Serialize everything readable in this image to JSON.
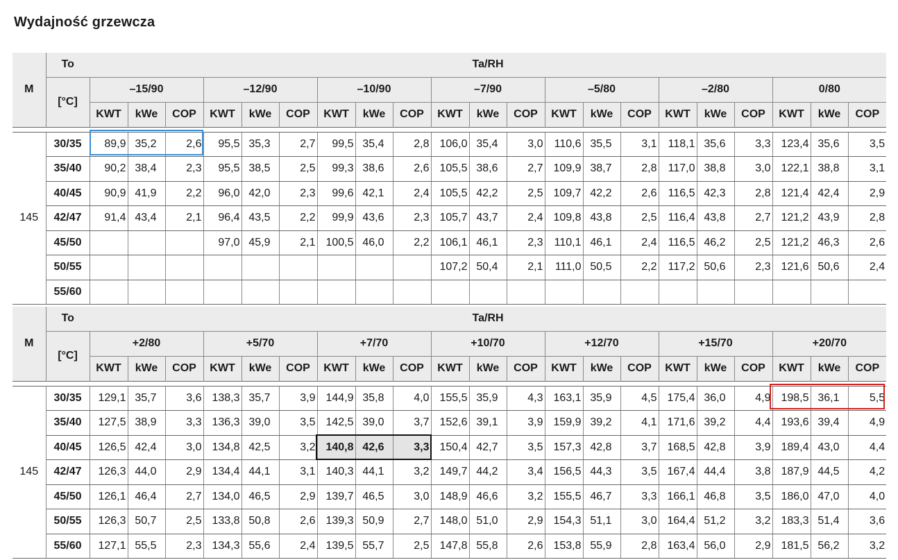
{
  "title": "Wydajność grzewcza",
  "labels": {
    "m": "M",
    "to": "To",
    "deg": "[°C]",
    "tarh": "Ta/RH",
    "kwt": "KWT",
    "kwe": "kWe",
    "cop": "COP"
  },
  "tables": [
    {
      "model": "145",
      "groups": [
        "–15/90",
        "–12/90",
        "–10/90",
        "–7/90",
        "–5/80",
        "–2/80",
        "0/80"
      ],
      "rows": [
        {
          "to": "30/35",
          "cells": [
            "89,9",
            "35,2",
            "2,6",
            "95,5",
            "35,3",
            "2,7",
            "99,5",
            "35,4",
            "2,8",
            "106,0",
            "35,4",
            "3,0",
            "110,6",
            "35,5",
            "3,1",
            "118,1",
            "35,6",
            "3,3",
            "123,4",
            "35,6",
            "3,5"
          ]
        },
        {
          "to": "35/40",
          "cells": [
            "90,2",
            "38,4",
            "2,3",
            "95,5",
            "38,5",
            "2,5",
            "99,3",
            "38,6",
            "2,6",
            "105,5",
            "38,6",
            "2,7",
            "109,9",
            "38,7",
            "2,8",
            "117,0",
            "38,8",
            "3,0",
            "122,1",
            "38,8",
            "3,1"
          ]
        },
        {
          "to": "40/45",
          "cells": [
            "90,9",
            "41,9",
            "2,2",
            "96,0",
            "42,0",
            "2,3",
            "99,6",
            "42,1",
            "2,4",
            "105,5",
            "42,2",
            "2,5",
            "109,7",
            "42,2",
            "2,6",
            "116,5",
            "42,3",
            "2,8",
            "121,4",
            "42,4",
            "2,9"
          ]
        },
        {
          "to": "42/47",
          "cells": [
            "91,4",
            "43,4",
            "2,1",
            "96,4",
            "43,5",
            "2,2",
            "99,9",
            "43,6",
            "2,3",
            "105,7",
            "43,7",
            "2,4",
            "109,8",
            "43,8",
            "2,5",
            "116,4",
            "43,8",
            "2,7",
            "121,2",
            "43,9",
            "2,8"
          ]
        },
        {
          "to": "45/50",
          "cells": [
            "",
            "",
            "",
            "97,0",
            "45,9",
            "2,1",
            "100,5",
            "46,0",
            "2,2",
            "106,1",
            "46,1",
            "2,3",
            "110,1",
            "46,1",
            "2,4",
            "116,5",
            "46,2",
            "2,5",
            "121,2",
            "46,3",
            "2,6"
          ]
        },
        {
          "to": "50/55",
          "cells": [
            "",
            "",
            "",
            "",
            "",
            "",
            "",
            "",
            "",
            "107,2",
            "50,4",
            "2,1",
            "111,0",
            "50,5",
            "2,2",
            "117,2",
            "50,6",
            "2,3",
            "121,6",
            "50,6",
            "2,4"
          ]
        },
        {
          "to": "55/60",
          "cells": [
            "",
            "",
            "",
            "",
            "",
            "",
            "",
            "",
            "",
            "",
            "",
            "",
            "",
            "",
            "",
            "",
            "",
            "",
            "",
            "",
            ""
          ]
        }
      ]
    },
    {
      "model": "145",
      "groups": [
        "+2/80",
        "+5/70",
        "+7/70",
        "+10/70",
        "+12/70",
        "+15/70",
        "+20/70"
      ],
      "rows": [
        {
          "to": "30/35",
          "cells": [
            "129,1",
            "35,7",
            "3,6",
            "138,3",
            "35,7",
            "3,9",
            "144,9",
            "35,8",
            "4,0",
            "155,5",
            "35,9",
            "4,3",
            "163,1",
            "35,9",
            "4,5",
            "175,4",
            "36,0",
            "4,9",
            "198,5",
            "36,1",
            "5,5"
          ]
        },
        {
          "to": "35/40",
          "cells": [
            "127,5",
            "38,9",
            "3,3",
            "136,3",
            "39,0",
            "3,5",
            "142,5",
            "39,0",
            "3,7",
            "152,6",
            "39,1",
            "3,9",
            "159,9",
            "39,2",
            "4,1",
            "171,6",
            "39,2",
            "4,4",
            "193,6",
            "39,4",
            "4,9"
          ]
        },
        {
          "to": "40/45",
          "cells": [
            "126,5",
            "42,4",
            "3,0",
            "134,8",
            "42,5",
            "3,2",
            "140,8",
            "42,6",
            "3,3",
            "150,4",
            "42,7",
            "3,5",
            "157,3",
            "42,8",
            "3,7",
            "168,5",
            "42,8",
            "3,9",
            "189,4",
            "43,0",
            "4,4"
          ]
        },
        {
          "to": "42/47",
          "cells": [
            "126,3",
            "44,0",
            "2,9",
            "134,4",
            "44,1",
            "3,1",
            "140,3",
            "44,1",
            "3,2",
            "149,7",
            "44,2",
            "3,4",
            "156,5",
            "44,3",
            "3,5",
            "167,4",
            "44,4",
            "3,8",
            "187,9",
            "44,5",
            "4,2"
          ]
        },
        {
          "to": "45/50",
          "cells": [
            "126,1",
            "46,4",
            "2,7",
            "134,0",
            "46,5",
            "2,9",
            "139,7",
            "46,5",
            "3,0",
            "148,9",
            "46,6",
            "3,2",
            "155,5",
            "46,7",
            "3,3",
            "166,1",
            "46,8",
            "3,5",
            "186,0",
            "47,0",
            "4,0"
          ]
        },
        {
          "to": "50/55",
          "cells": [
            "126,3",
            "50,7",
            "2,5",
            "133,8",
            "50,8",
            "2,6",
            "139,3",
            "50,9",
            "2,7",
            "148,0",
            "51,0",
            "2,9",
            "154,3",
            "51,1",
            "3,0",
            "164,4",
            "51,2",
            "3,2",
            "183,3",
            "51,4",
            "3,6"
          ]
        },
        {
          "to": "55/60",
          "cells": [
            "127,1",
            "55,5",
            "2,3",
            "134,3",
            "55,6",
            "2,4",
            "139,5",
            "55,7",
            "2,5",
            "147,8",
            "55,8",
            "2,6",
            "153,8",
            "55,9",
            "2,8",
            "163,4",
            "56,0",
            "2,9",
            "181,5",
            "56,2",
            "3,2"
          ]
        }
      ]
    }
  ],
  "highlights": [
    {
      "table": 0,
      "row": 0,
      "group": 0,
      "color": "#3b8fd6"
    },
    {
      "table": 1,
      "row": 2,
      "group": 2,
      "color": "#111111",
      "bold": true
    },
    {
      "table": 1,
      "row": 0,
      "group": 6,
      "color": "#d42020"
    }
  ]
}
